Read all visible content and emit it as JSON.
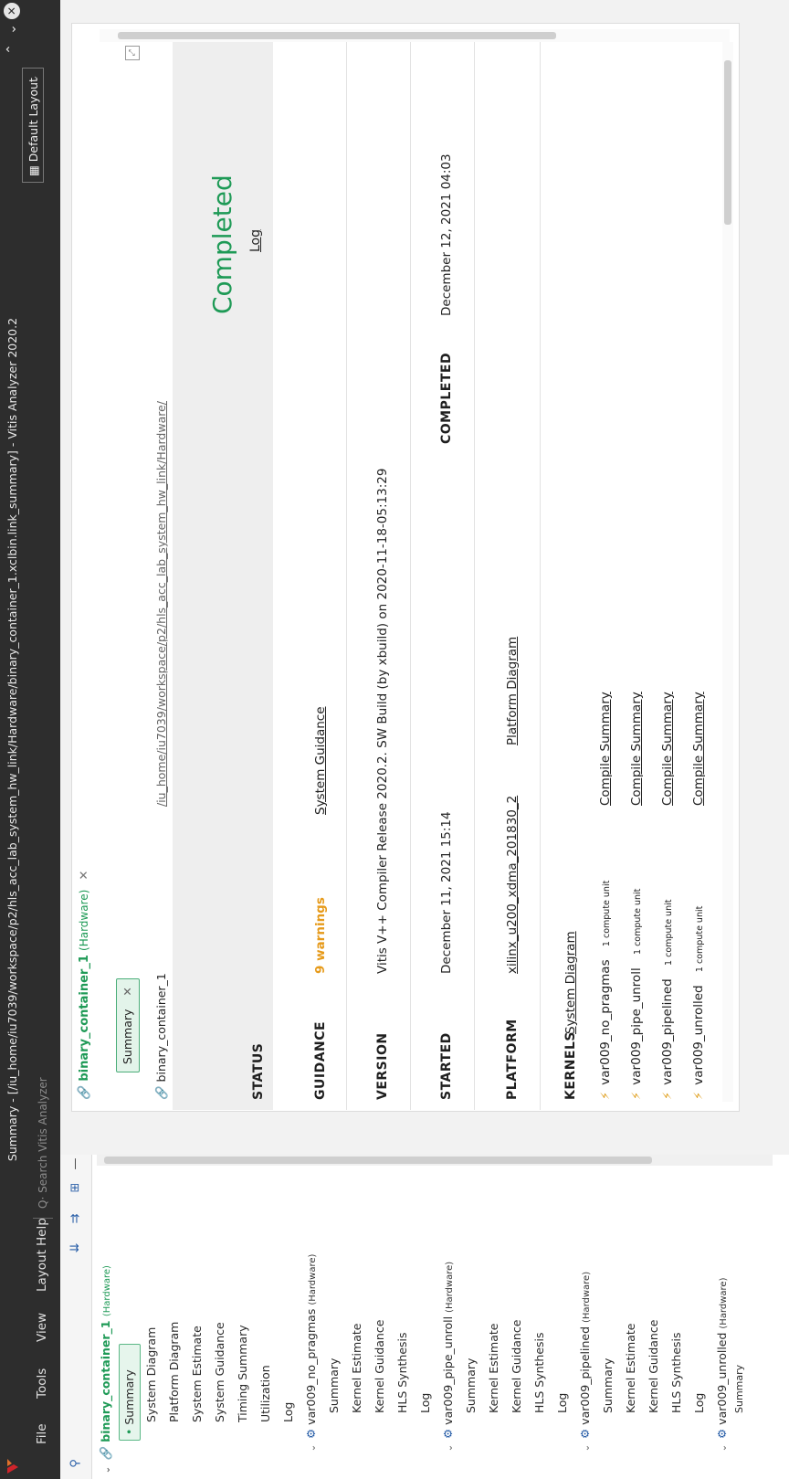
{
  "window": {
    "title": "Summary - [/iu_home/iu7039/workspace/p2/hls_acc_lab_system_hw_link/Hardware/binary_container_1.xclbin.link_summary] - Vitis Analyzer 2020.2",
    "close_glyph": "✕",
    "collapse_glyph": "⌃",
    "expand_glyph": "⌄"
  },
  "menubar": {
    "file": "File",
    "tools": "Tools",
    "view": "View",
    "layout": "Layout",
    "help": "Help",
    "search_placeholder": "Search Vitis Analyzer",
    "default_layout": "Default Layout"
  },
  "tree": {
    "root": {
      "name": "binary_container_1",
      "tag": "(Hardware)"
    },
    "root_items": [
      "Summary",
      "System Diagram",
      "Platform Diagram",
      "System Estimate",
      "System Guidance",
      "Timing Summary",
      "Utilization",
      "Log"
    ],
    "kernels": [
      {
        "name": "var009_no_pragmas",
        "tag": "(Hardware)",
        "items": [
          "Summary",
          "Kernel Estimate",
          "Kernel Guidance",
          "HLS Synthesis",
          "Log"
        ]
      },
      {
        "name": "var009_pipe_unroll",
        "tag": "(Hardware)",
        "items": [
          "Summary",
          "Kernel Estimate",
          "Kernel Guidance",
          "HLS Synthesis",
          "Log"
        ]
      },
      {
        "name": "var009_pipelined",
        "tag": "(Hardware)",
        "items": [
          "Summary",
          "Kernel Estimate",
          "Kernel Guidance",
          "HLS Synthesis",
          "Log"
        ]
      },
      {
        "name": "var009_unrolled",
        "tag": "(Hardware)",
        "items": [
          "Summary"
        ]
      }
    ]
  },
  "summary": {
    "tab_title": "binary_container_1",
    "tab_tag": "(Hardware)",
    "pill": "Summary",
    "crumb": "binary_container_1",
    "path": "/iu_home/iu7039/workspace/p2/hls_acc_lab_system_hw_link/Hardware/",
    "status_label": "STATUS",
    "status_value": "Completed",
    "status_log": "Log",
    "guidance_label": "GUIDANCE",
    "guidance_warnings": "9 warnings",
    "guidance_link": "System Guidance",
    "version_label": "VERSION",
    "version_value": "Vitis V++ Compiler Release 2020.2. SW Build (by xbuild) on 2020-11-18-05:13:29",
    "started_label": "STARTED",
    "started_value": "December 11, 2021 15:14",
    "completed_label": "COMPLETED",
    "completed_value": "December 12, 2021 04:03",
    "platform_label": "PLATFORM",
    "platform_value": "xilinx_u200_xdma_201830_2",
    "platform_link": "Platform Diagram",
    "kernels_label": "KERNELS",
    "kernels_link": "System Diagram",
    "kernel_rows": [
      {
        "name": "var009_no_pragmas",
        "units": "1 compute unit",
        "link": "Compile Summary"
      },
      {
        "name": "var009_pipe_unroll",
        "units": "1 compute unit",
        "link": "Compile Summary"
      },
      {
        "name": "var009_pipelined",
        "units": "1 compute unit",
        "link": "Compile Summary"
      },
      {
        "name": "var009_unrolled",
        "units": "1 compute unit",
        "link": "Compile Summary"
      }
    ]
  },
  "colors": {
    "accent_green": "#1e9a56",
    "warning_orange": "#e69a1a",
    "titlebar": "#2d2d2d"
  }
}
